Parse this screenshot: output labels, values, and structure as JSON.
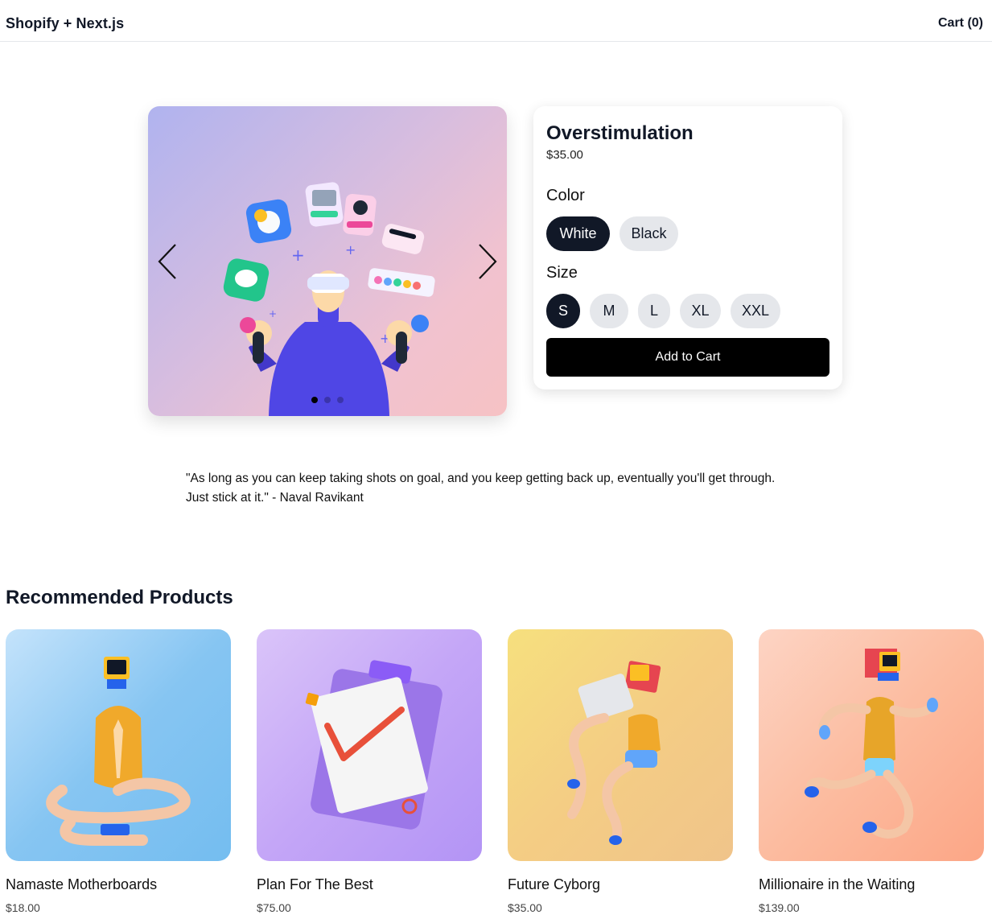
{
  "header": {
    "brand": "Shopify + Next.js",
    "cart_label": "Cart (0)"
  },
  "product": {
    "title": "Overstimulation",
    "price": "$35.00",
    "color_label": "Color",
    "colors": [
      "White",
      "Black"
    ],
    "selected_color": "White",
    "size_label": "Size",
    "sizes": [
      "S",
      "M",
      "L",
      "XL",
      "XXL"
    ],
    "selected_size": "S",
    "add_to_cart": "Add to Cart",
    "gallery": {
      "slide_count": 3,
      "active_slide": 1
    }
  },
  "quote": {
    "line1": "\"As long as you can keep taking shots on goal, and you keep getting back up, eventually you'll get through.",
    "line2": "Just stick at it.\" - Naval Ravikant"
  },
  "recommended": {
    "heading": "Recommended Products",
    "items": [
      {
        "name": "Namaste Motherboards",
        "price": "$18.00"
      },
      {
        "name": "Plan For The Best",
        "price": "$75.00"
      },
      {
        "name": "Future Cyborg",
        "price": "$35.00"
      },
      {
        "name": "Millionaire in the Waiting",
        "price": "$139.00"
      }
    ]
  },
  "colors": {
    "dark": "#111827",
    "pill_bg": "#e5e7eb",
    "button": "#000000"
  }
}
